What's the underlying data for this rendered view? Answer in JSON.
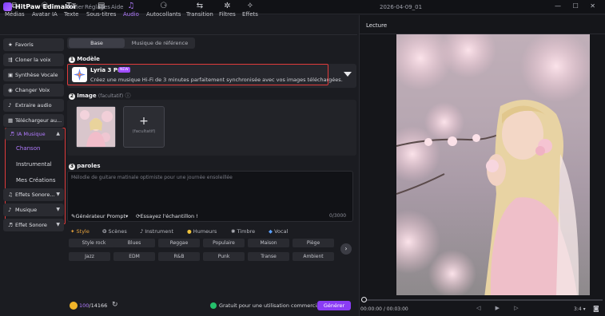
{
  "titlebar": {
    "app_name": "HitPaw Edimakor",
    "menu": [
      "Fichier",
      "Réglages",
      "Aide"
    ],
    "document": "2026-04-09_01",
    "controls": "— ☐ ✕"
  },
  "toolbar": {
    "tools": [
      {
        "label": "Médias",
        "icon": "media-icon",
        "glyph": "⧉"
      },
      {
        "label": "Avatar IA",
        "icon": "avatar-icon",
        "glyph": "⚇"
      },
      {
        "label": "Texte",
        "icon": "text-icon",
        "glyph": "Tт"
      },
      {
        "label": "Sous-titres",
        "icon": "subtitles-icon",
        "glyph": "▤"
      },
      {
        "label": "Audio",
        "icon": "audio-icon",
        "glyph": "♫"
      },
      {
        "label": "Autocollants",
        "icon": "stickers-icon",
        "glyph": "⚆"
      },
      {
        "label": "Transition",
        "icon": "transition-icon",
        "glyph": "⇆"
      },
      {
        "label": "Filtres",
        "icon": "filters-icon",
        "glyph": "✲"
      },
      {
        "label": "Effets",
        "icon": "effects-icon",
        "glyph": "✧"
      }
    ],
    "active": "Audio"
  },
  "sidebar": {
    "items": [
      {
        "label": "Favoris",
        "glyph": "★"
      },
      {
        "label": "Cloner la voix",
        "glyph": "⇶"
      },
      {
        "label": "Synthèse Vocale",
        "glyph": "▣"
      },
      {
        "label": "Changer Voix",
        "glyph": "◉"
      },
      {
        "label": "Extraire audio",
        "glyph": "♪"
      },
      {
        "label": "Téléchargeur au...",
        "glyph": "▦"
      }
    ],
    "ia_music": {
      "label": "IA Musique",
      "glyph": "♬",
      "sub": [
        "Chanson",
        "Instrumental",
        "Mes Créations"
      ],
      "selected": "Chanson"
    },
    "bottom": [
      {
        "label": "Effets Sonore...",
        "glyph": "♫"
      },
      {
        "label": "Musique",
        "glyph": "♪"
      },
      {
        "label": "Effet Sonore",
        "glyph": "♬"
      }
    ]
  },
  "main": {
    "tabs": [
      "Base",
      "Musique de référence"
    ],
    "active_tab": "Base",
    "model": {
      "num": "1",
      "title": "Modèle",
      "name": "Lyria 3 Pro",
      "badge": "NEW",
      "desc": "Créez une musique Hi-Fi de 3 minutes parfaitement synchronisée avec vos images téléchargées."
    },
    "image": {
      "num": "2",
      "title": "Image",
      "optional": "(facultatif)",
      "info": "ⓘ",
      "add_label": "(facultatif)"
    },
    "lyrics": {
      "num": "3",
      "title": "paroles",
      "placeholder": "Mélodie de guitare matinale optimiste pour une journée ensoleillée",
      "generator": "Générateur Prompt",
      "sample": "Essayez l'échantillon !",
      "count": "0/3000"
    },
    "style_tabs": [
      {
        "label": "Style",
        "glyph": "✦"
      },
      {
        "label": "Scènes",
        "glyph": "❂"
      },
      {
        "label": "Instrument",
        "glyph": "♪"
      },
      {
        "label": "Humeurs",
        "glyph": "●"
      },
      {
        "label": "Timbre",
        "glyph": "✺"
      },
      {
        "label": "Vocal",
        "glyph": "◆"
      }
    ],
    "active_style_tab": "Style",
    "styles_row1": [
      "Style rock",
      "Blues",
      "Reggae",
      "Populaire",
      "Maison",
      "Piège"
    ],
    "styles_row2": [
      "Jazz",
      "EDM",
      "R&B",
      "Punk",
      "Transe",
      "Ambient"
    ],
    "footer": {
      "credits_used": "100",
      "credits_total": "/14166",
      "free_text": "Gratuit pour une utilisation commerciale",
      "generate": "Générer"
    }
  },
  "preview": {
    "title": "Lecture",
    "time": "00:00:00 / 00:03:00",
    "ratio": "3:4",
    "controls": "◁ ▶ ▷"
  },
  "colors": {
    "accent": "#8a3cf5",
    "highlight": "#e03b3b",
    "active_text": "#b27bff"
  }
}
